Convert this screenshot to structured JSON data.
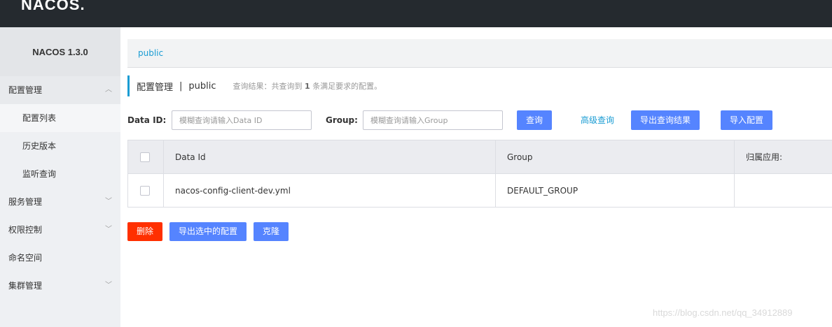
{
  "header": {
    "logo": "NACOS."
  },
  "sidebar": {
    "title": "NACOS 1.3.0",
    "items": [
      {
        "label": "配置管理",
        "icon": "chevron-up-icon",
        "chev": "︿"
      },
      {
        "label": "配置列表"
      },
      {
        "label": "历史版本"
      },
      {
        "label": "监听查询"
      },
      {
        "label": "服务管理",
        "icon": "chevron-down-icon",
        "chev": "﹀"
      },
      {
        "label": "权限控制",
        "icon": "chevron-down-icon",
        "chev": "﹀"
      },
      {
        "label": "命名空间"
      },
      {
        "label": "集群管理",
        "icon": "chevron-down-icon",
        "chev": "﹀"
      }
    ]
  },
  "breadcrumb": {
    "namespace": "public"
  },
  "title": {
    "main": "配置管理",
    "separator": "|",
    "namespace": "public",
    "hint_prefix": "查询结果：共查询到",
    "count": "1",
    "hint_suffix": "条满足要求的配置。"
  },
  "filter": {
    "data_id_label": "Data ID:",
    "data_id_placeholder": "模糊查询请输入Data ID",
    "group_label": "Group:",
    "group_placeholder": "模糊查询请输入Group",
    "query_button": "查询",
    "advanced_link": "高级查询",
    "export_results_button": "导出查询结果",
    "import_button": "导入配置"
  },
  "table": {
    "columns": [
      "Data Id",
      "Group",
      "归属应用:"
    ],
    "rows": [
      {
        "data_id": "nacos-config-client-dev.yml",
        "group": "DEFAULT_GROUP",
        "app": ""
      }
    ]
  },
  "actions": {
    "delete_button": "删除",
    "export_selected_button": "导出选中的配置",
    "clone_button": "克隆"
  },
  "watermark": "https://blog.csdn.net/qq_34912889",
  "colors": {
    "accent": "#1a9cd3",
    "primary_button": "#5584ff",
    "danger_button": "#ff3000",
    "topbar": "#252a2f"
  }
}
